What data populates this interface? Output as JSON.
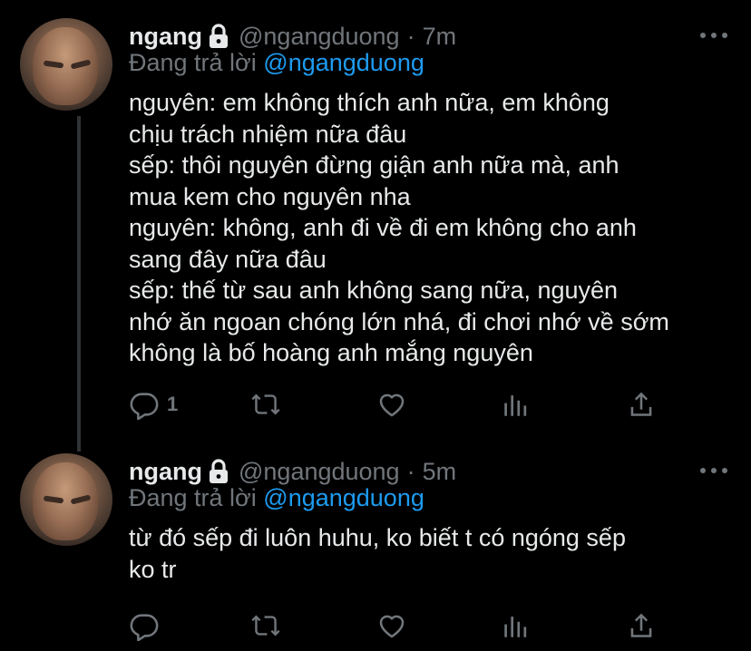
{
  "tweets": [
    {
      "author": {
        "name": "ngang",
        "handle": "@ngangduong",
        "time": "7m",
        "protected": true
      },
      "reply_prefix": "Đang trả lời",
      "reply_to": "@ngangduong",
      "lines": [
        "nguyên: em không thích anh nữa, em không",
        "chịu trách nhiệm nữa đâu",
        "sếp: thôi nguyên đừng giận anh nữa mà, anh",
        "mua kem cho nguyên nha",
        "nguyên: không, anh đi về đi em không cho anh",
        "sang đây nữa đâu",
        "sếp: thế từ sau anh không sang nữa, nguyên",
        "nhớ ăn ngoan chóng lớn nhá, đi chơi nhớ về sớm",
        "không là bố hoàng anh mắng nguyên"
      ],
      "reply_count": "1"
    },
    {
      "author": {
        "name": "ngang",
        "handle": "@ngangduong",
        "time": "5m",
        "protected": true
      },
      "reply_prefix": "Đang trả lời",
      "reply_to": "@ngangduong",
      "lines": [
        "từ đó sếp đi luôn huhu, ko biết t có ngóng sếp",
        "ko tr"
      ],
      "reply_count": ""
    }
  ],
  "separator": "·",
  "icons": {
    "reply": "reply-icon",
    "retweet": "retweet-icon",
    "like": "like-icon",
    "views": "views-icon",
    "share": "share-icon",
    "lock": "lock-icon",
    "more": "more-icon"
  },
  "colors": {
    "background": "#000000",
    "text": "#e7e9ea",
    "muted": "#71767b",
    "accent": "#1d9bf0"
  }
}
